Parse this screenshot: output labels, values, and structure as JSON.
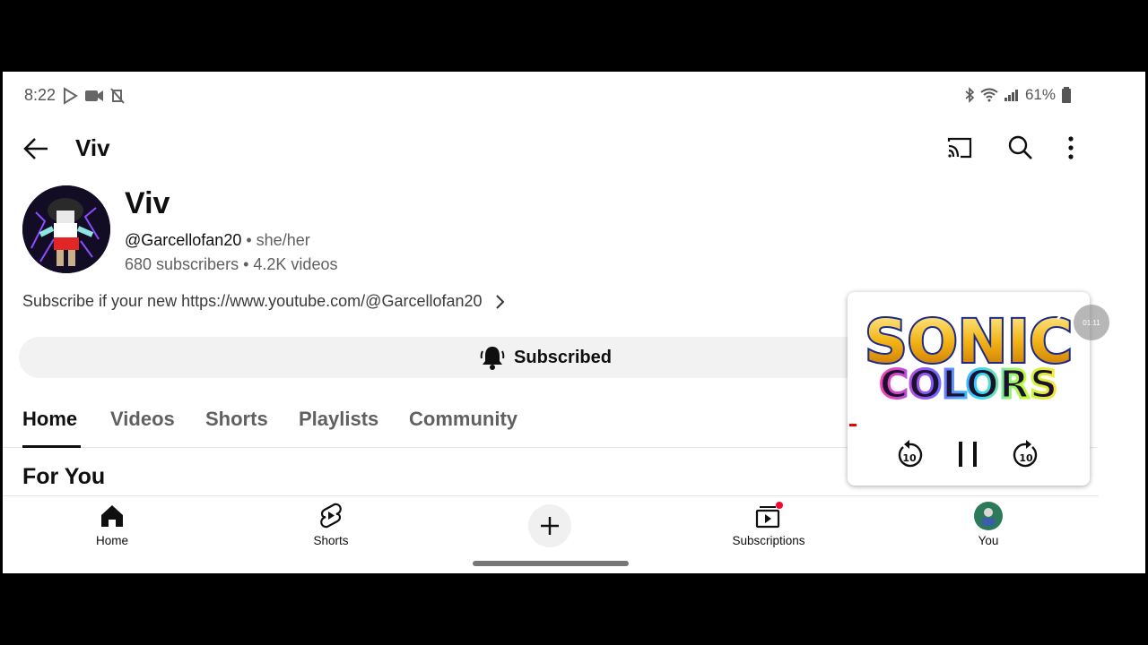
{
  "status": {
    "time": "8:22",
    "battery": "61%"
  },
  "appbar": {
    "title": "Viv"
  },
  "channel": {
    "name": "Viv",
    "handle": "@Garcellofan20",
    "pronouns": "she/her",
    "subscribers": "680 subscribers",
    "videos": "4.2K videos",
    "description": "Subscribe if your new https://www.youtube.com/@Garcellofan20",
    "subscribe_label": "Subscribed"
  },
  "tabs": [
    "Home",
    "Videos",
    "Shorts",
    "Playlists",
    "Community"
  ],
  "section_title": "For You",
  "bottom_nav": {
    "home": "Home",
    "shorts": "Shorts",
    "subscriptions": "Subscriptions",
    "you": "You"
  },
  "mini_player": {
    "line1": "SONIC",
    "line2": "COLORS",
    "overlay_time": "01:11"
  },
  "colors": {
    "accent_red": "#ff0033",
    "text": "#0f0f0f",
    "muted": "#606060"
  }
}
